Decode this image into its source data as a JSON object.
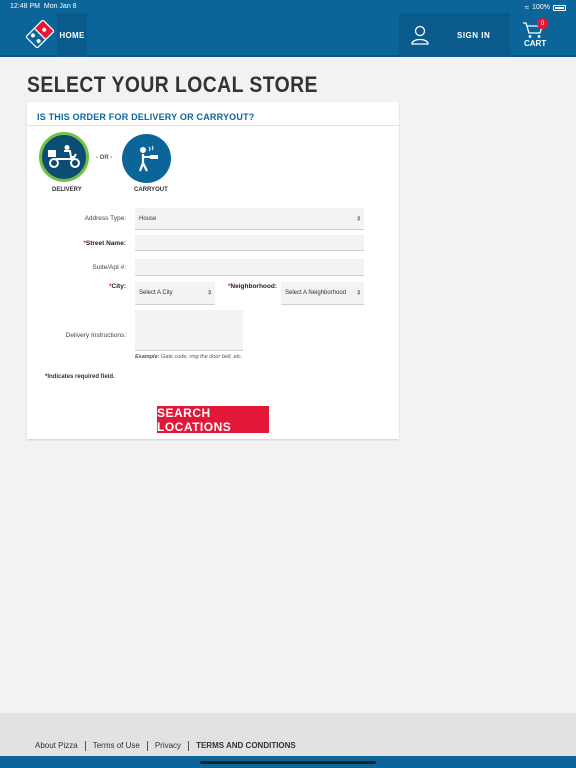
{
  "status": {
    "time": "12:48 PM",
    "date": "Mon Jan 8",
    "battery": "100%"
  },
  "nav": {
    "home": "HOME",
    "signin": "SIGN IN",
    "cart": "CART",
    "cart_count": "0"
  },
  "page_title": "SELECT YOUR LOCAL STORE",
  "form": {
    "heading": "IS THIS ORDER FOR DELIVERY OR CARRYOUT?",
    "delivery_label": "DELIVERY",
    "or_label": "- OR -",
    "carryout_label": "CARRYOUT",
    "address_type_label": "Address Type:",
    "address_type_value": "House",
    "street_label": "Street Name:",
    "street_value": "",
    "suite_label": "Suite/Apt #:",
    "suite_value": "",
    "city_label": "City:",
    "city_value": "Select A City",
    "neighborhood_label": "Neighborhood:",
    "neighborhood_value": "Select A Neighborhood",
    "instructions_label": "Delivery Instructions:",
    "instructions_value": "",
    "example_prefix": "Example:",
    "example_text": "Gate code, ring the door bell, etc.",
    "required_note": "*Indicates required field.",
    "submit": "SEARCH LOCATIONS"
  },
  "footer": {
    "links": [
      "About Pizza",
      "Terms of Use",
      "Privacy",
      "TERMS AND CONDITIONS"
    ]
  },
  "colors": {
    "brand_blue": "#0c6599",
    "brand_red": "#e31837",
    "selected_green": "#74c143"
  }
}
